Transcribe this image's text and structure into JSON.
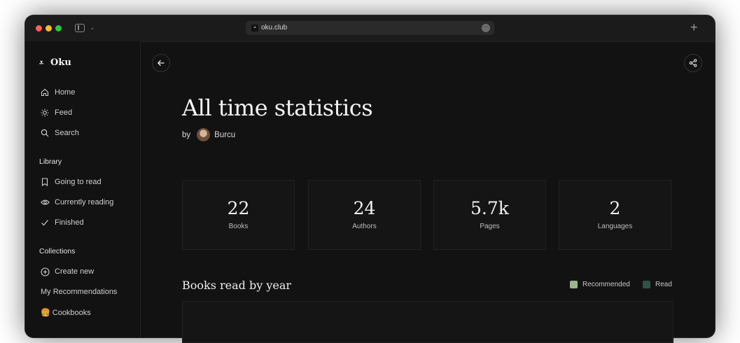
{
  "browser": {
    "url": "oku.club"
  },
  "sidebar": {
    "logo": "Oku",
    "nav": [
      {
        "label": "Home"
      },
      {
        "label": "Feed"
      },
      {
        "label": "Search"
      }
    ],
    "library_label": "Library",
    "library": [
      {
        "label": "Going to read"
      },
      {
        "label": "Currently reading"
      },
      {
        "label": "Finished"
      }
    ],
    "collections_label": "Collections",
    "collections": [
      {
        "label": "Create new"
      },
      {
        "label": "My Recommendations"
      },
      {
        "label": "🍔 Cookbooks"
      }
    ]
  },
  "page": {
    "title": "All time statistics",
    "by": "by",
    "author": "Burcu"
  },
  "stats": [
    {
      "value": "22",
      "label": "Books"
    },
    {
      "value": "24",
      "label": "Authors"
    },
    {
      "value": "5.7k",
      "label": "Pages"
    },
    {
      "value": "2",
      "label": "Languages"
    }
  ],
  "chart": {
    "title": "Books read by year",
    "legend": [
      {
        "label": "Recommended",
        "color": "#9bb58c"
      },
      {
        "label": "Read",
        "color": "#2f5446"
      }
    ]
  },
  "icons": {
    "logo": "oku-logo-icon",
    "back": "arrow-left-icon",
    "share": "share-icon",
    "home": "home-icon",
    "feed": "sun-icon",
    "search": "search-icon",
    "going": "bookmark-icon",
    "reading": "eye-icon",
    "finished": "check-icon",
    "create": "plus-circle-icon"
  }
}
